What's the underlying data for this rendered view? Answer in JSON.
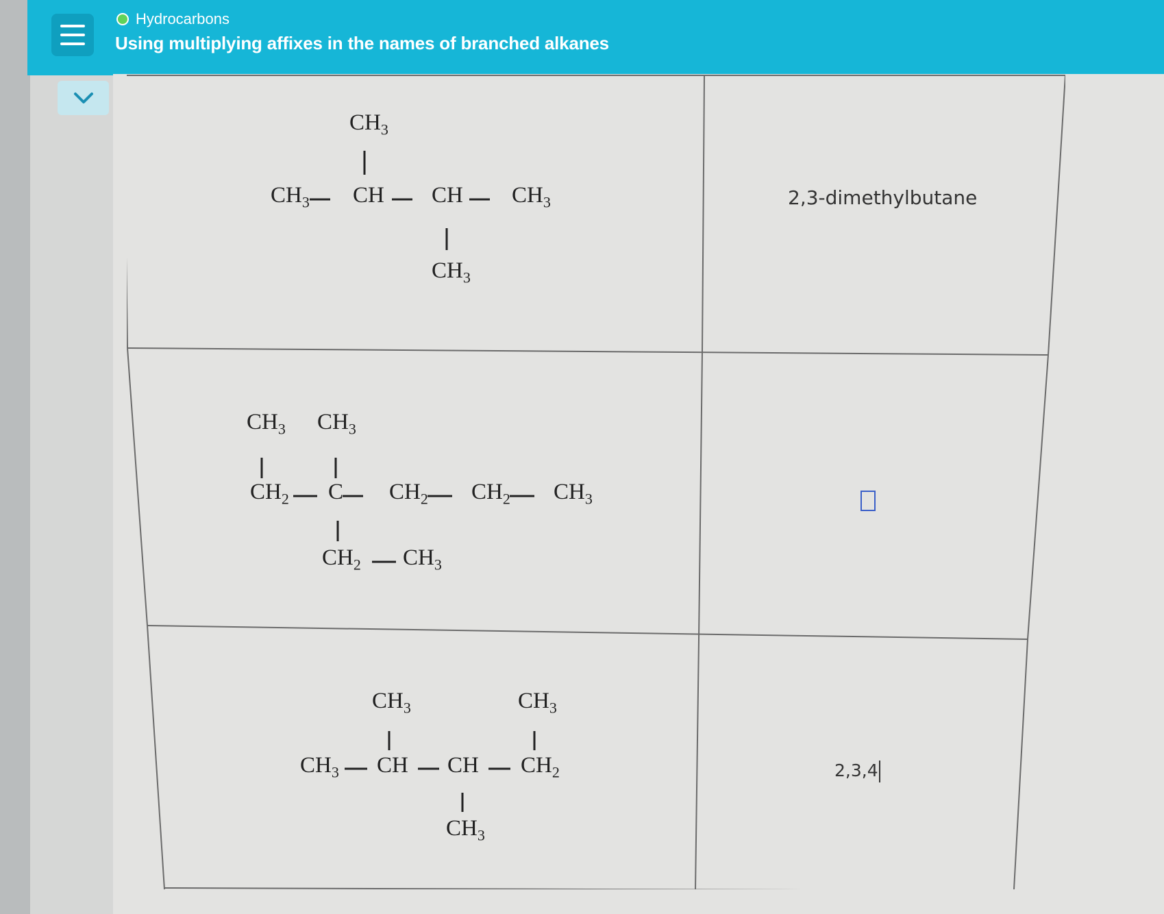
{
  "header": {
    "topic": "Hydrocarbons",
    "title": "Using multiplying affixes in the names of branched alkanes"
  },
  "rows": [
    {
      "answer_text": "2,3-dimethylbutane",
      "answer_state": "given"
    },
    {
      "answer_text": "",
      "answer_state": "empty"
    },
    {
      "answer_text": "2,3,4",
      "answer_state": "typing"
    }
  ],
  "formula": {
    "ch3": "CH",
    "ch2": "CH",
    "ch": "CH",
    "c": "C",
    "sub3": "3",
    "sub2": "2"
  },
  "colors": {
    "header_bg": "#16b6d7",
    "accent_input_border": "#3a5fc8",
    "topic_dot": "#5fd35a"
  },
  "icons": {
    "menu": "hamburger-menu-icon",
    "collapse": "chevron-down-icon",
    "status": "circle-status-icon"
  }
}
